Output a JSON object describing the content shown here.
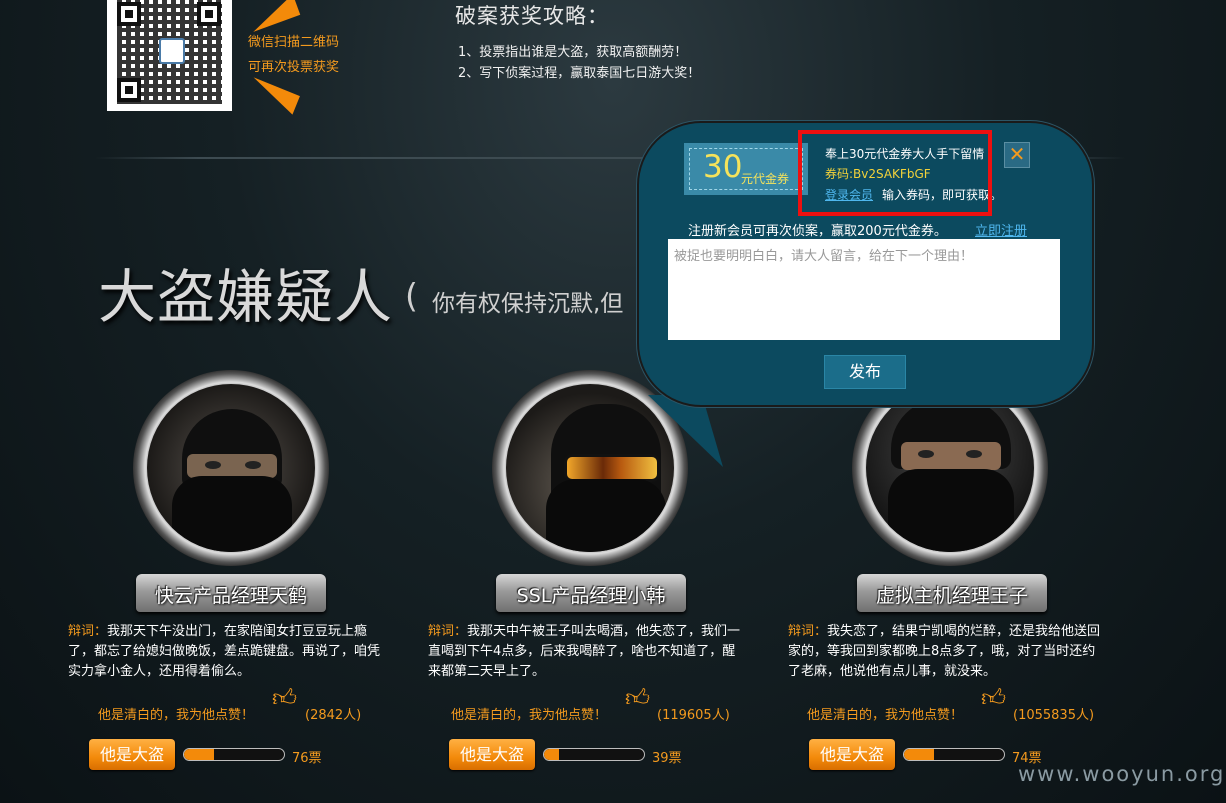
{
  "header": {
    "qr_line1": "微信扫描二维码",
    "qr_line2": "可再次投票获奖",
    "title": "破案获奖攻略：",
    "tips": [
      "1、投票指出谁是大盗，获取高额酬劳！",
      "2、写下侦案过程，赢取泰国七日游大奖！"
    ]
  },
  "section": {
    "title": "大盗嫌疑人",
    "paren": "(",
    "subtitle": "你有权保持沉默,但"
  },
  "suspects": [
    {
      "name": "快云产品经理天鹤",
      "defense_label": "辩词：",
      "defense": "我那天下午没出门，在家陪闺女打豆豆玩上瘾了，都忘了给媳妇做晚饭，差点跪键盘。再说了，咱凭实力拿小金人，还用得着偷么。",
      "like_text": "他是清白的，我为他点赞！",
      "like_count": "(2842人)",
      "button": "他是大盗",
      "vote_fraction": 0.3,
      "votes": "76票"
    },
    {
      "name": "SSL产品经理小韩",
      "defense_label": "辩词：",
      "defense": "我那天中午被王子叫去喝酒，他失恋了，我们一直喝到下午4点多，后来我喝醉了，啥也不知道了，醒来都第二天早上了。",
      "like_text": "他是清白的，我为他点赞！",
      "like_count": "(119605人)",
      "button": "他是大盗",
      "vote_fraction": 0.15,
      "votes": "39票"
    },
    {
      "name": "虚拟主机经理王子",
      "defense_label": "辩词：",
      "defense": "我失恋了，结果宁凯喝的烂醉，还是我给他送回家的，等我回到家都晚上8点多了，哦，对了当时还约了老麻，他说他有点儿事，就没来。",
      "like_text": "他是清白的，我为他点赞！",
      "like_count": "(1055835人)",
      "button": "他是大盗",
      "vote_fraction": 0.3,
      "votes": "74票"
    }
  ],
  "popup": {
    "coupon_amount": "30",
    "coupon_unit": "元代金券",
    "line1": "奉上30元代金券大人手下留情",
    "code": "券码:Bv2SAKFbGF",
    "login_link": "登录会员",
    "login_rest": "输入券码，即可获取。",
    "register_text": "注册新会员可再次侦案，赢取200元代金券。",
    "register_link": "立即注册",
    "textarea_placeholder": "被捉也要明明白白，请大人留言，给在下一个理由！",
    "submit": "发布",
    "close_icon": "close-icon"
  },
  "watermark": "www.wooyun.org",
  "colors": {
    "accent": "#f39a1e",
    "popup_bg": "#0c4a5f",
    "highlight_box": "#ee1010",
    "link": "#4fb7ee"
  }
}
